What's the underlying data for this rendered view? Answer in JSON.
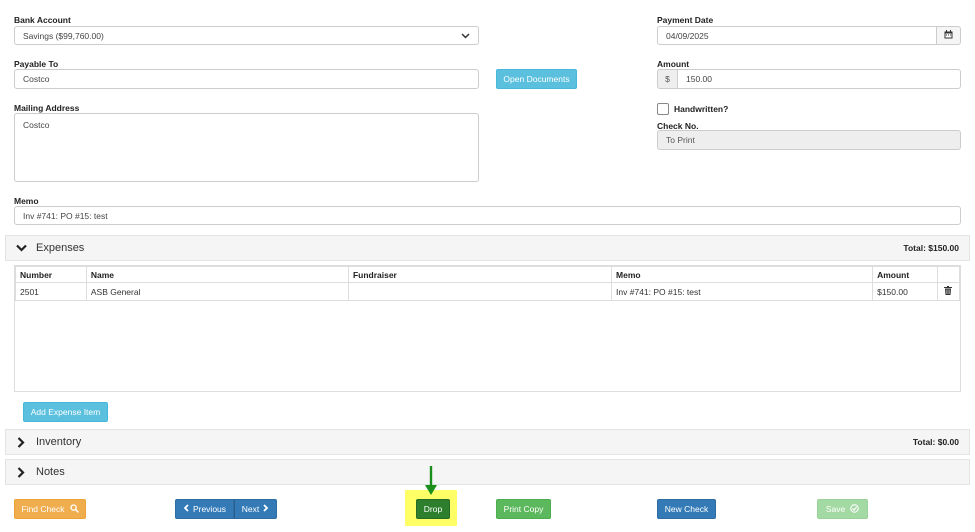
{
  "form": {
    "bank_account_label": "Bank Account",
    "bank_account_value": "Savings ($99,760.00)",
    "payment_date_label": "Payment Date",
    "payment_date_value": "04/09/2025",
    "payable_to_label": "Payable To",
    "payable_to_value": "Costco",
    "open_documents_label": "Open Documents",
    "amount_label": "Amount",
    "amount_prefix": "$",
    "amount_value": "150.00",
    "mailing_address_label": "Mailing Address",
    "mailing_address_value": "Costco",
    "handwritten_label": "Handwritten?",
    "handwritten_checked": false,
    "check_no_label": "Check No.",
    "check_no_value": "To Print",
    "memo_label": "Memo",
    "memo_value": "Inv #741: PO #15: test"
  },
  "expenses": {
    "title": "Expenses",
    "total": "Total: $150.00",
    "columns": [
      "Number",
      "Name",
      "Fundraiser",
      "Memo",
      "Amount"
    ],
    "rows": [
      {
        "number": "2501",
        "name": "ASB General",
        "fundraiser": "",
        "memo": "Inv #741: PO #15: test",
        "amount": "$150.00"
      }
    ],
    "add_label": "Add Expense Item"
  },
  "inventory": {
    "title": "Inventory",
    "total": "Total: $0.00"
  },
  "notes": {
    "title": "Notes"
  },
  "footer": {
    "find_check_label": "Find Check",
    "previous_label": "Previous",
    "next_label": "Next",
    "drop_label": "Drop",
    "print_copy_label": "Print Copy",
    "new_check_label": "New Check",
    "save_label": "Save"
  },
  "colors": {
    "info": "#5bc0de",
    "warning": "#f0ad4e",
    "primary": "#337ab7",
    "success": "#5cb85c",
    "highlight": "#ffff66",
    "arrow": "#1a8f1a"
  }
}
